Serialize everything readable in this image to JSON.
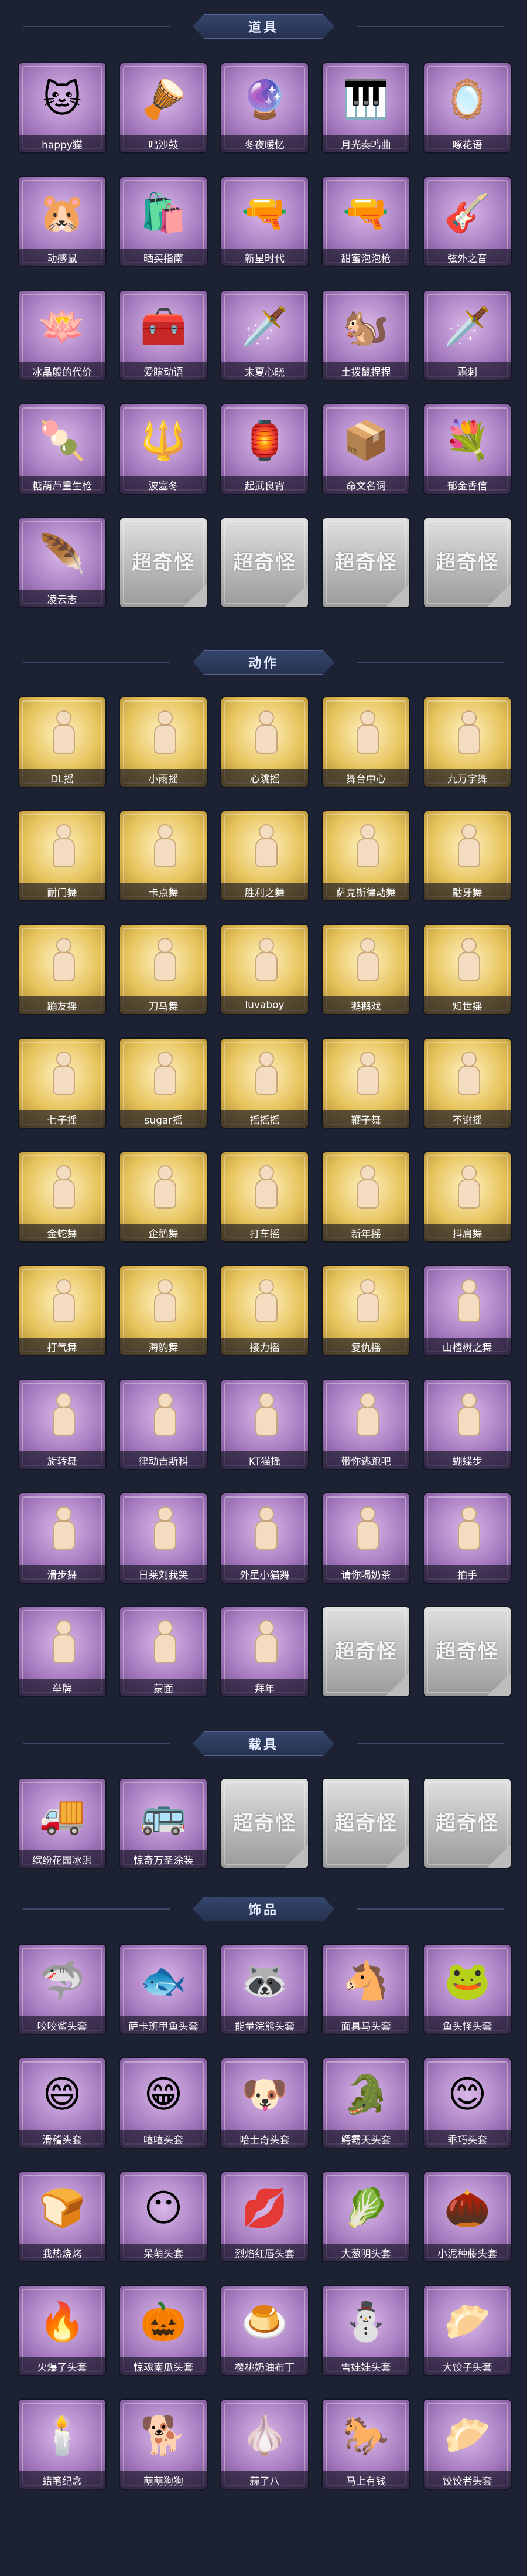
{
  "sections": [
    {
      "title": "道具",
      "items": [
        {
          "label": "happy猫",
          "style": "purple",
          "icon": "🐱"
        },
        {
          "label": "鸣沙鼓",
          "style": "purple",
          "icon": "🪘"
        },
        {
          "label": "冬夜暖忆",
          "style": "purple",
          "icon": "🔮"
        },
        {
          "label": "月光奏鸣曲",
          "style": "purple",
          "icon": "🎹"
        },
        {
          "label": "啄花语",
          "style": "purple",
          "icon": "🪞"
        },
        {
          "label": "动感鼠",
          "style": "purple",
          "icon": "🐹"
        },
        {
          "label": "晒买指南",
          "style": "purple",
          "icon": "🛍️"
        },
        {
          "label": "新星时代",
          "style": "purple",
          "icon": "🔫"
        },
        {
          "label": "甜蜜泡泡枪",
          "style": "purple",
          "icon": "🔫"
        },
        {
          "label": "弦外之音",
          "style": "purple",
          "icon": "🎸"
        },
        {
          "label": "冰晶般的代价",
          "style": "purple",
          "icon": "🪷"
        },
        {
          "label": "爱瞎动语",
          "style": "purple",
          "icon": "🧰"
        },
        {
          "label": "末夏心晓",
          "style": "purple",
          "icon": "🗡️"
        },
        {
          "label": "土拨鼠捏捏",
          "style": "purple",
          "icon": "🐿️"
        },
        {
          "label": "霜刺",
          "style": "purple",
          "icon": "🗡️"
        },
        {
          "label": "糖葫芦重生枪",
          "style": "purple",
          "icon": "🍡"
        },
        {
          "label": "波塞冬",
          "style": "purple",
          "icon": "🔱"
        },
        {
          "label": "起武良宵",
          "style": "purple",
          "icon": "🏮"
        },
        {
          "label": "命文名词",
          "style": "purple",
          "icon": "📦"
        },
        {
          "label": "郁金香信",
          "style": "purple",
          "icon": "💐"
        },
        {
          "label": "凌云志",
          "style": "purple",
          "icon": "🪶"
        },
        {
          "label": "",
          "style": "empty",
          "icon": ""
        },
        {
          "label": "",
          "style": "empty",
          "icon": ""
        },
        {
          "label": "",
          "style": "empty",
          "icon": ""
        },
        {
          "label": "",
          "style": "empty",
          "icon": ""
        }
      ]
    },
    {
      "title": "动作",
      "items": [
        {
          "label": "DL摇",
          "style": "gold",
          "icon": "figure"
        },
        {
          "label": "小雨摇",
          "style": "gold",
          "icon": "figure"
        },
        {
          "label": "心跳摇",
          "style": "gold",
          "icon": "figure"
        },
        {
          "label": "舞台中心",
          "style": "gold",
          "icon": "figure"
        },
        {
          "label": "九万字舞",
          "style": "gold",
          "icon": "figure"
        },
        {
          "label": "耐门舞",
          "style": "gold",
          "icon": "figure"
        },
        {
          "label": "卡点舞",
          "style": "gold",
          "icon": "figure"
        },
        {
          "label": "胜利之舞",
          "style": "gold",
          "icon": "figure"
        },
        {
          "label": "萨克斯律动舞",
          "style": "gold",
          "icon": "figure"
        },
        {
          "label": "骷牙舞",
          "style": "gold",
          "icon": "figure"
        },
        {
          "label": "蹦友摇",
          "style": "gold",
          "icon": "figure"
        },
        {
          "label": "刀马舞",
          "style": "gold",
          "icon": "figure"
        },
        {
          "label": "luvaboy",
          "style": "gold",
          "icon": "figure"
        },
        {
          "label": "鹅鹅戏",
          "style": "gold",
          "icon": "figure"
        },
        {
          "label": "知世摇",
          "style": "gold",
          "icon": "figure"
        },
        {
          "label": "七子摇",
          "style": "gold",
          "icon": "figure"
        },
        {
          "label": "sugar摇",
          "style": "gold",
          "icon": "figure"
        },
        {
          "label": "摇摇摇",
          "style": "gold",
          "icon": "figure"
        },
        {
          "label": "鞭子舞",
          "style": "gold",
          "icon": "figure"
        },
        {
          "label": "不谢摇",
          "style": "gold",
          "icon": "figure"
        },
        {
          "label": "金蛇舞",
          "style": "gold",
          "icon": "figure"
        },
        {
          "label": "企鹅舞",
          "style": "gold",
          "icon": "figure"
        },
        {
          "label": "打车摇",
          "style": "gold",
          "icon": "figure"
        },
        {
          "label": "新年摇",
          "style": "gold",
          "icon": "figure"
        },
        {
          "label": "抖肩舞",
          "style": "gold",
          "icon": "figure"
        },
        {
          "label": "打气舞",
          "style": "gold",
          "icon": "figure"
        },
        {
          "label": "海豹舞",
          "style": "gold",
          "icon": "figure"
        },
        {
          "label": "接力摇",
          "style": "gold",
          "icon": "figure"
        },
        {
          "label": "复仇摇",
          "style": "gold",
          "icon": "figure"
        },
        {
          "label": "山楂树之舞",
          "style": "purple",
          "icon": "figure"
        },
        {
          "label": "旋转舞",
          "style": "purple",
          "icon": "figure"
        },
        {
          "label": "律动吉斯科",
          "style": "purple",
          "icon": "figure"
        },
        {
          "label": "KT猫摇",
          "style": "purple",
          "icon": "figure"
        },
        {
          "label": "带你逃跑吧",
          "style": "purple",
          "icon": "figure"
        },
        {
          "label": "蝴蝶步",
          "style": "purple",
          "icon": "figure"
        },
        {
          "label": "滑步舞",
          "style": "purple",
          "icon": "figure"
        },
        {
          "label": "日莱刘我笑",
          "style": "purple",
          "icon": "figure"
        },
        {
          "label": "外星小猫舞",
          "style": "purple",
          "icon": "figure"
        },
        {
          "label": "请你喝奶茶",
          "style": "purple",
          "icon": "figure"
        },
        {
          "label": "拍手",
          "style": "purple",
          "icon": "figure"
        },
        {
          "label": "举牌",
          "style": "purple",
          "icon": "figure"
        },
        {
          "label": "蒙面",
          "style": "purple",
          "icon": "figure"
        },
        {
          "label": "拜年",
          "style": "purple",
          "icon": "figure"
        },
        {
          "label": "",
          "style": "empty",
          "icon": ""
        },
        {
          "label": "",
          "style": "empty",
          "icon": ""
        }
      ]
    },
    {
      "title": "载具",
      "items": [
        {
          "label": "缤纷花园冰淇",
          "style": "purple",
          "icon": "🚚"
        },
        {
          "label": "惊奇万圣涂装",
          "style": "purple",
          "icon": "🚌"
        },
        {
          "label": "",
          "style": "empty",
          "icon": ""
        },
        {
          "label": "",
          "style": "empty",
          "icon": ""
        },
        {
          "label": "",
          "style": "empty",
          "icon": ""
        }
      ]
    },
    {
      "title": "饰品",
      "items": [
        {
          "label": "咬咬鲨头套",
          "style": "purple",
          "icon": "🦈"
        },
        {
          "label": "萨卡班甲鱼头套",
          "style": "purple",
          "icon": "🐟"
        },
        {
          "label": "能量浣熊头套",
          "style": "purple",
          "icon": "🦝"
        },
        {
          "label": "面具马头套",
          "style": "purple",
          "icon": "🐴"
        },
        {
          "label": "鱼头怪头套",
          "style": "purple",
          "icon": "🐸"
        },
        {
          "label": "滑稽头套",
          "style": "purple",
          "icon": "😄"
        },
        {
          "label": "嘻嘻头套",
          "style": "purple",
          "icon": "😁"
        },
        {
          "label": "哈士奇头套",
          "style": "purple",
          "icon": "🐶"
        },
        {
          "label": "鳄霸天头套",
          "style": "purple",
          "icon": "🐊"
        },
        {
          "label": "乖巧头套",
          "style": "purple",
          "icon": "😊"
        },
        {
          "label": "我热烧烤",
          "style": "purple",
          "icon": "🍞"
        },
        {
          "label": "呆萌头套",
          "style": "purple",
          "icon": "😶"
        },
        {
          "label": "烈焰红唇头套",
          "style": "purple",
          "icon": "💋"
        },
        {
          "label": "大葱明头套",
          "style": "purple",
          "icon": "🥬"
        },
        {
          "label": "小泥种藤头套",
          "style": "purple",
          "icon": "🌰"
        },
        {
          "label": "火爆了头套",
          "style": "purple",
          "icon": "🔥"
        },
        {
          "label": "惊魂南瓜头套",
          "style": "purple",
          "icon": "🎃"
        },
        {
          "label": "樱桃奶油布丁",
          "style": "purple",
          "icon": "🍮"
        },
        {
          "label": "雪娃娃头套",
          "style": "purple",
          "icon": "⛄"
        },
        {
          "label": "大饺子头套",
          "style": "purple",
          "icon": "🥟"
        },
        {
          "label": "蜡笔纪念",
          "style": "purple",
          "icon": "🕯️"
        },
        {
          "label": "萌萌狗狗",
          "style": "purple",
          "icon": "🐕"
        },
        {
          "label": "蒜了八",
          "style": "purple",
          "icon": "🧄"
        },
        {
          "label": "马上有钱",
          "style": "purple",
          "icon": "🐎"
        },
        {
          "label": "饺饺者头套",
          "style": "purple",
          "icon": "🥟"
        }
      ]
    }
  ],
  "empty_placeholder": "超奇怪"
}
